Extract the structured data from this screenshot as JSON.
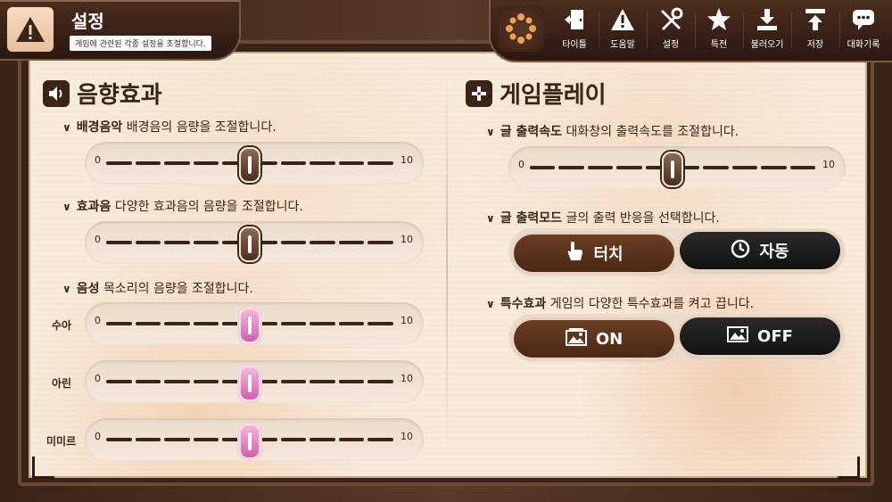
{
  "header": {
    "title": "설정",
    "subtitle": "게임에 관련된 각종 설정을 조절합니다."
  },
  "toolbar": {
    "items": [
      {
        "label": "타이틀",
        "icon": "exit-door-icon"
      },
      {
        "label": "도움말",
        "icon": "warning-icon"
      },
      {
        "label": "설정",
        "icon": "tools-icon"
      },
      {
        "label": "특전",
        "icon": "star-icon"
      },
      {
        "label": "불러오기",
        "icon": "download-icon"
      },
      {
        "label": "저장",
        "icon": "upload-icon"
      },
      {
        "label": "대화기록",
        "icon": "chat-icon"
      }
    ]
  },
  "sound": {
    "section_title": "음향효과",
    "bgm": {
      "label": "배경음악",
      "desc": "배경음의 음량을 조절합니다.",
      "min": "0",
      "max": "10",
      "value": 5
    },
    "sfx": {
      "label": "효과음",
      "desc": "다양한 효과음의 음량을 조절합니다.",
      "min": "0",
      "max": "10",
      "value": 5
    },
    "voice": {
      "label": "음성",
      "desc": "목소리의 음량을 조절합니다.",
      "characters": [
        {
          "name": "수아",
          "min": "0",
          "max": "10",
          "value": 5
        },
        {
          "name": "아린",
          "min": "0",
          "max": "10",
          "value": 5
        },
        {
          "name": "미미르",
          "min": "0",
          "max": "10",
          "value": 5
        }
      ]
    }
  },
  "gameplay": {
    "section_title": "게임플레이",
    "text_speed": {
      "label": "글 출력속도",
      "desc": "대화창의 출력속도를 조절합니다.",
      "min": "0",
      "max": "10",
      "value": 5
    },
    "text_mode": {
      "label": "글 출력모드",
      "desc": "글의 출력 반응을 선택합니다.",
      "option_touch": "터치",
      "option_auto": "자동",
      "selected": "터치"
    },
    "effects": {
      "label": "특수효과",
      "desc": "게임의 다양한 특수효과를 켜고 끕니다.",
      "option_on": "ON",
      "option_off": "OFF",
      "selected": "ON"
    }
  },
  "colors": {
    "accent_brown": "#4a2814",
    "dark": "#111111",
    "knob_pink": "#d35db0"
  }
}
